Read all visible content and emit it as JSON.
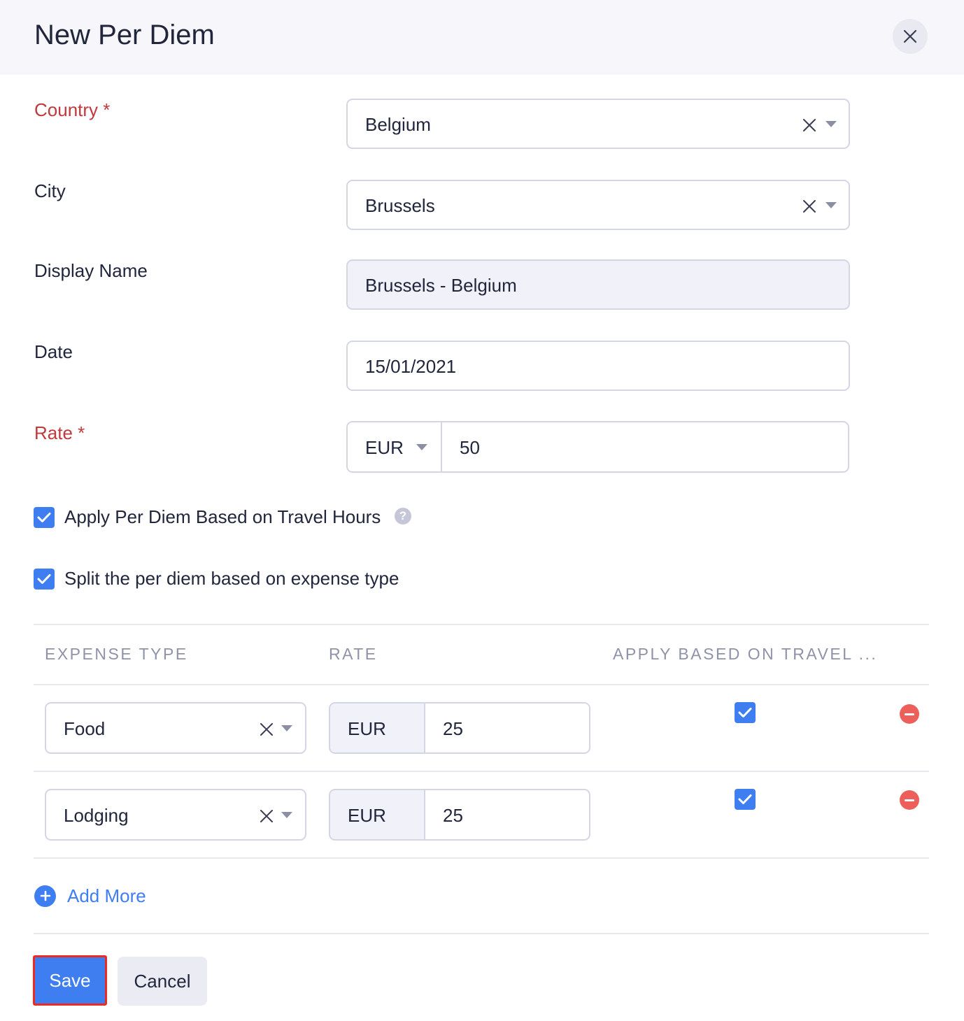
{
  "dialog": {
    "title": "New Per Diem"
  },
  "form": {
    "country": {
      "label": "Country *",
      "value": "Belgium"
    },
    "city": {
      "label": "City",
      "value": "Brussels"
    },
    "display_name": {
      "label": "Display Name",
      "value": "Brussels - Belgium"
    },
    "date": {
      "label": "Date",
      "value": "15/01/2021"
    },
    "rate": {
      "label": "Rate *",
      "currency": "EUR",
      "amount": "50"
    }
  },
  "options": {
    "apply_travel_hours": {
      "label": "Apply Per Diem Based on Travel Hours",
      "checked": true
    },
    "split_expense_type": {
      "label": "Split the per diem based on expense type",
      "checked": true
    }
  },
  "table": {
    "headers": [
      "EXPENSE TYPE",
      "RATE",
      "APPLY BASED ON TRAVEL ..."
    ],
    "rows": [
      {
        "expense_type": "Food",
        "currency": "EUR",
        "rate": "25",
        "apply_travel": true
      },
      {
        "expense_type": "Lodging",
        "currency": "EUR",
        "rate": "25",
        "apply_travel": true
      }
    ]
  },
  "actions": {
    "add_more": "Add More",
    "save": "Save",
    "cancel": "Cancel"
  },
  "colors": {
    "primary": "#3f7ef0",
    "required_label": "#c0393c",
    "remove": "#ec5f5a",
    "highlight_border": "#ee2a1e"
  },
  "icons": [
    "close-icon",
    "clear-icon",
    "chevron-down-icon",
    "check-icon",
    "help-icon",
    "remove-icon",
    "plus-icon"
  ]
}
